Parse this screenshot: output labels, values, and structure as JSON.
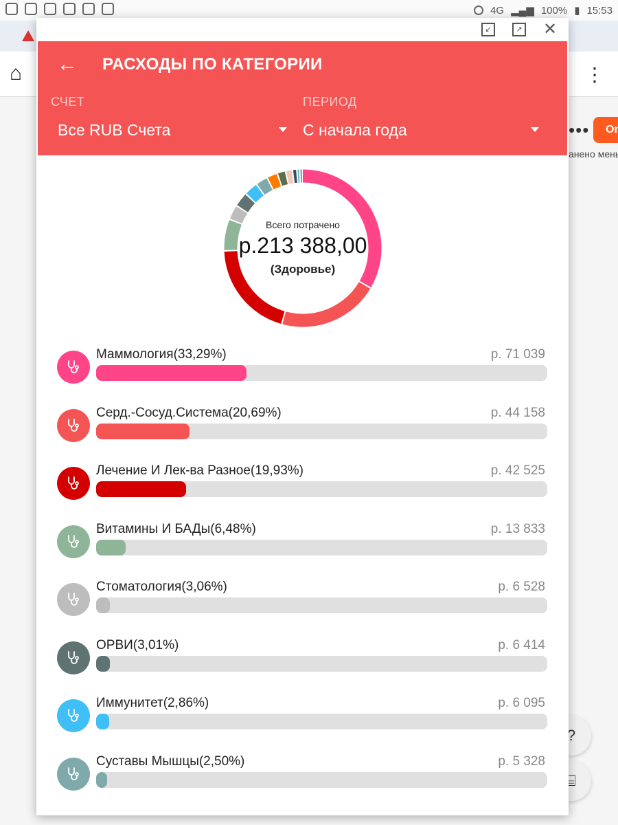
{
  "status_bar": {
    "battery": "100%",
    "time": "15:53",
    "network": "4G"
  },
  "background": {
    "partial_button": "On",
    "partial_text": "анено меньше"
  },
  "dialog": {
    "title": "РАСХОДЫ ПО КАТЕГОРИИ",
    "account": {
      "label": "СЧЕТ",
      "value": "Все RUB Счета"
    },
    "period": {
      "label": "ПЕРИОД",
      "value": "С начала года"
    },
    "summary": {
      "label": "Всего потрачено",
      "amount": "р.213 388,00",
      "category": "(Здоровье)"
    }
  },
  "colors": {
    "header": "#f45454",
    "track": "#e0e0e0"
  },
  "categories": [
    {
      "name": "Маммология(33,29%)",
      "amount": "р. 71 039",
      "percent": 33.29,
      "color": "#ff4587"
    },
    {
      "name": "Серд.-Сосуд.Система(20,69%)",
      "amount": "р. 44 158",
      "percent": 20.69,
      "color": "#f45454"
    },
    {
      "name": "Лечение И Лек-ва Разное(19,93%)",
      "amount": "р. 42 525",
      "percent": 19.93,
      "color": "#d40000"
    },
    {
      "name": "Витамины И БАДы(6,48%)",
      "amount": "р. 13 833",
      "percent": 6.48,
      "color": "#8fb598"
    },
    {
      "name": "Стоматология(3,06%)",
      "amount": "р. 6 528",
      "percent": 3.06,
      "color": "#bdbdbd"
    },
    {
      "name": "ОРВИ(3,01%)",
      "amount": "р. 6 414",
      "percent": 3.01,
      "color": "#5f7373"
    },
    {
      "name": "Иммунитет(2,86%)",
      "amount": "р. 6 095",
      "percent": 2.86,
      "color": "#3fbff5"
    },
    {
      "name": "Суставы Мышцы(2,50%)",
      "amount": "р. 5 328",
      "percent": 2.5,
      "color": "#80a9ab"
    }
  ],
  "chart_data": {
    "type": "pie",
    "title": "Всего потрачено",
    "total": "р.213 388,00",
    "categories": [
      "Маммология",
      "Серд.-Сосуд.Система",
      "Лечение И Лек-ва Разное",
      "Витамины И БАДы",
      "Стоматология",
      "ОРВИ",
      "Иммунитет",
      "Суставы Мышцы"
    ],
    "values": [
      33.29,
      20.69,
      19.93,
      6.48,
      3.06,
      3.01,
      2.86,
      2.5
    ],
    "colors": [
      "#ff4587",
      "#f45454",
      "#d40000",
      "#8fb598",
      "#bdbdbd",
      "#5f7373",
      "#3fbff5",
      "#80a9ab",
      "#ff7a00",
      "#5c6e4c",
      "#f4c8b8",
      "#3a4a5c",
      "#68b7c7",
      "#445566"
    ],
    "small_slices": [
      2.2,
      1.7,
      1.4,
      0.9,
      0.6,
      0.5
    ]
  }
}
